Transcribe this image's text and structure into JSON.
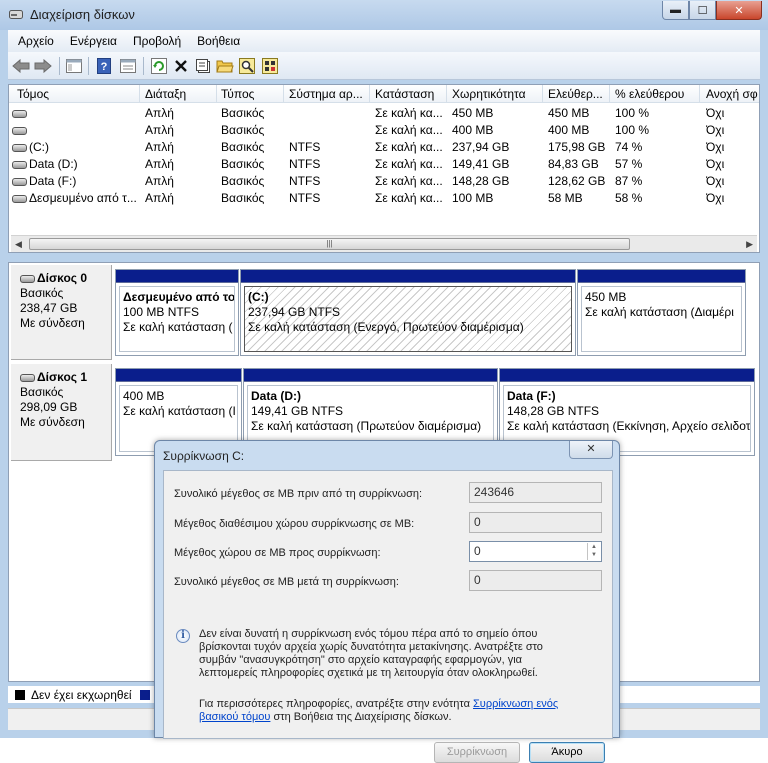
{
  "window": {
    "title": "Διαχείριση δίσκων"
  },
  "menu": [
    "Αρχείο",
    "Ενέργεια",
    "Προβολή",
    "Βοήθεια"
  ],
  "volume_table": {
    "headers": [
      "Τόμος",
      "Διάταξη",
      "Τύπος",
      "Σύστημα αρ...",
      "Κατάσταση",
      "Χωρητικότητα",
      "Ελεύθερ...",
      "% ελεύθερου",
      "Ανοχή σφ"
    ],
    "rows": [
      [
        "",
        "Απλή",
        "Βασικός",
        "",
        "Σε καλή κα...",
        "450 MB",
        "450 MB",
        "100 %",
        "Όχι"
      ],
      [
        "",
        "Απλή",
        "Βασικός",
        "",
        "Σε καλή κα...",
        "400 MB",
        "400 MB",
        "100 %",
        "Όχι"
      ],
      [
        "(C:)",
        "Απλή",
        "Βασικός",
        "NTFS",
        "Σε καλή κα...",
        "237,94 GB",
        "175,98 GB",
        "74 %",
        "Όχι"
      ],
      [
        "Data  (D:)",
        "Απλή",
        "Βασικός",
        "NTFS",
        "Σε καλή κα...",
        "149,41 GB",
        "84,83 GB",
        "57 %",
        "Όχι"
      ],
      [
        "Data (F:)",
        "Απλή",
        "Βασικός",
        "NTFS",
        "Σε καλή κα...",
        "148,28 GB",
        "128,62 GB",
        "87 %",
        "Όχι"
      ],
      [
        "Δεσμευμένο από τ...",
        "Απλή",
        "Βασικός",
        "NTFS",
        "Σε καλή κα...",
        "100 MB",
        "58 MB",
        "58 %",
        "Όχι"
      ]
    ]
  },
  "disks": [
    {
      "name": "Δίσκος 0",
      "type": "Βασικός",
      "size": "238,47 GB",
      "status": "Με σύνδεση",
      "partitions": [
        {
          "name": "Δεσμευμένο από το",
          "size": "100 MB NTFS",
          "status": "Σε καλή κατάσταση ("
        },
        {
          "name": "(C:)",
          "size": "237,94 GB NTFS",
          "status": "Σε καλή κατάσταση (Ενεργό, Πρωτεύον διαμέρισμα)"
        },
        {
          "name": "",
          "size": "450 MB",
          "status": "Σε καλή κατάσταση (Διαμέρι"
        }
      ]
    },
    {
      "name": "Δίσκος 1",
      "type": "Βασικός",
      "size": "298,09 GB",
      "status": "Με σύνδεση",
      "partitions": [
        {
          "name": "",
          "size": "400 MB",
          "status": "Σε καλή κατάσταση (Ι"
        },
        {
          "name": "Data   (D:)",
          "size": "149,41 GB NTFS",
          "status": "Σε καλή κατάσταση (Πρωτεύον διαμέρισμα)"
        },
        {
          "name": "Data  (F:)",
          "size": "148,28 GB NTFS",
          "status": "Σε καλή κατάσταση (Εκκίνηση, Αρχείο σελιδοτ"
        }
      ]
    }
  ],
  "legend": {
    "unallocated": "Δεν έχει εκχωρηθεί"
  },
  "dialog": {
    "title": "Συρρίκνωση C:",
    "close_label": "✕",
    "fields": [
      {
        "label": "Συνολικό μέγεθος σε MB πριν από τη συρρίκνωση:",
        "value": "243646"
      },
      {
        "label": "Μέγεθος διαθέσιμου χώρου συρρίκνωσης σε MB:",
        "value": "0"
      },
      {
        "label": "Μέγεθος χώρου σε MB προς συρρίκνωση:",
        "value": "0"
      },
      {
        "label": "Συνολικό μέγεθος σε MB μετά τη συρρίκνωση:",
        "value": "0"
      }
    ],
    "info_lines": [
      "Δεν είναι δυνατή η συρρίκνωση ενός τόμου πέρα από το σημείο όπου",
      "βρίσκονται τυχόν αρχεία χωρίς δυνατότητα μετακίνησης. Ανατρέξτε στο",
      "συμβάν \"ανασυγκρότηση\" στο αρχείο καταγραφής εφαρμογών, για",
      "λεπτομερείς πληροφορίες σχετικά με τη λειτουργία όταν ολοκληρωθεί."
    ],
    "more_prefix": "Για περισσότερες πληροφορίες, ανατρέξτε στην ενότητα ",
    "more_link_1": "Συρρίκνωση ενός",
    "more_link_2": "βασικού τόμου",
    "more_suffix": " στη Βοήθεια της Διαχείρισης δίσκων.",
    "shrink_button": "Συρρίκνωση",
    "cancel_button": "Άκυρο"
  },
  "colors": {
    "partition_bar": "#0a1e8c",
    "window_frame": "#b9d1ea"
  }
}
